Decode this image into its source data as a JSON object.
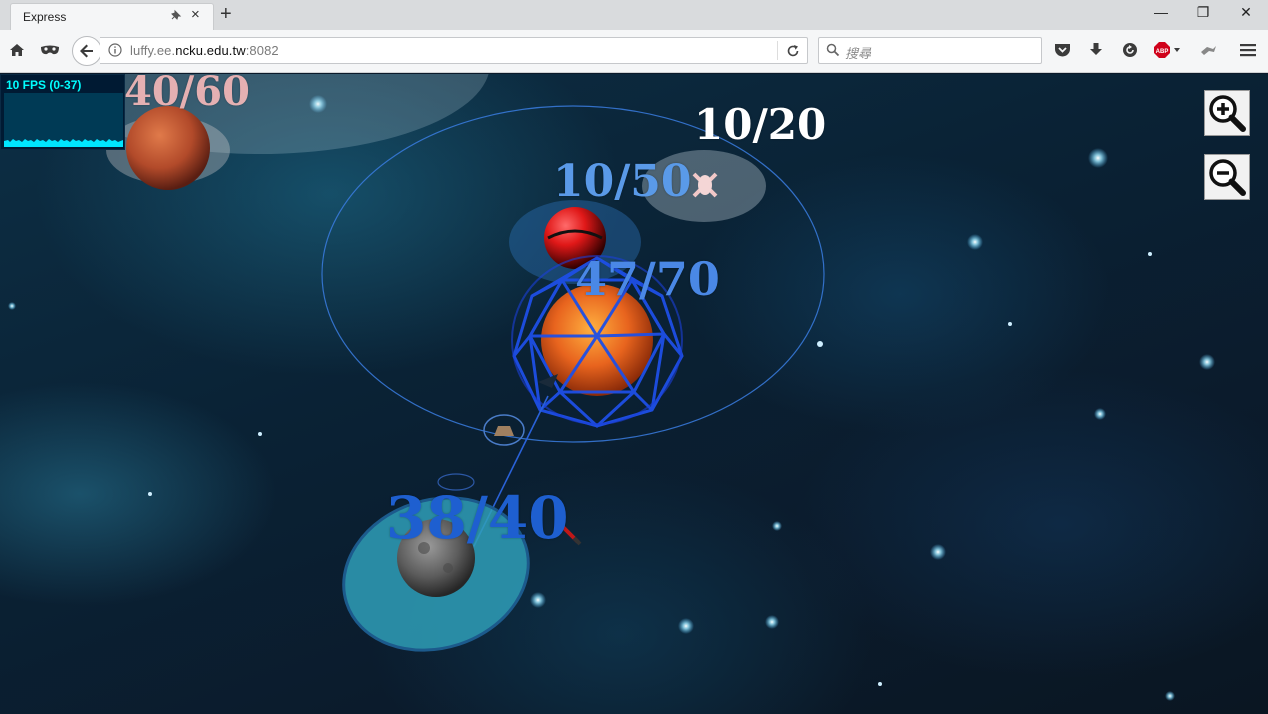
{
  "browser": {
    "tab_title": "Express",
    "new_tab_symbol": "+",
    "close_tab_symbol": "×",
    "url_prefix": "luffy.ee.",
    "url_domain": "ncku.edu.tw",
    "url_suffix": ":8082",
    "search_placeholder": "搜尋",
    "abp_label": "ABP",
    "window_controls": {
      "minimize": "—",
      "restore": "❐",
      "close": "✕"
    }
  },
  "game": {
    "fps_text": "10 FPS (0-37)",
    "planets": [
      {
        "label": "40/60",
        "color": "#f4b8b8"
      },
      {
        "label": "10/20",
        "color": "#ffffff"
      },
      {
        "label": "10/50",
        "color": "#5a9ae8"
      },
      {
        "label": "47/70",
        "color": "#4a88e6"
      },
      {
        "label": "38/40",
        "color": "#1e5fd0"
      }
    ],
    "zoom_in_icon": "zoom-in-icon",
    "zoom_out_icon": "zoom-out-icon",
    "colors": {
      "blue_team": "#2a6cff",
      "orbit": "#3a7de0",
      "shield": "#2f9fb8"
    }
  }
}
